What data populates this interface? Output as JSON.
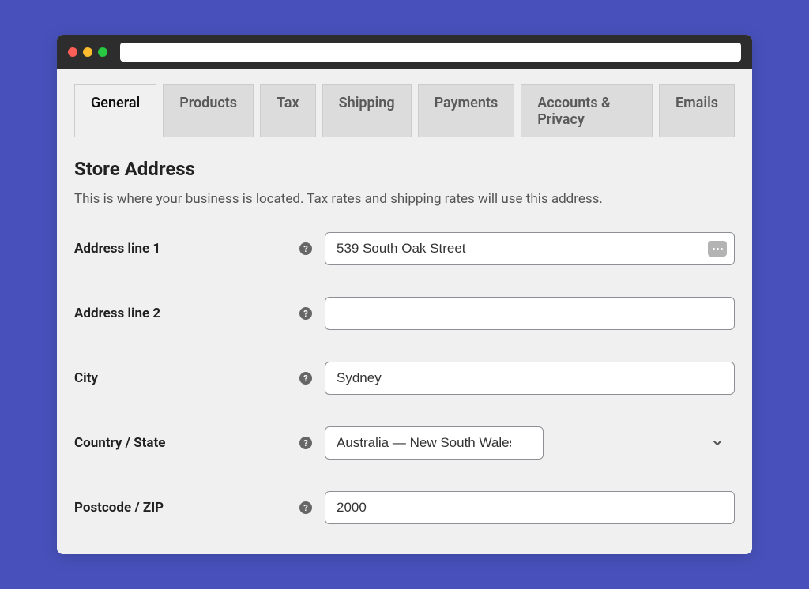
{
  "tabs": [
    {
      "label": "General",
      "active": true
    },
    {
      "label": "Products",
      "active": false
    },
    {
      "label": "Tax",
      "active": false
    },
    {
      "label": "Shipping",
      "active": false
    },
    {
      "label": "Payments",
      "active": false
    },
    {
      "label": "Accounts & Privacy",
      "active": false
    },
    {
      "label": "Emails",
      "active": false
    }
  ],
  "section": {
    "title": "Store Address",
    "description": "This is where your business is located. Tax rates and shipping rates will use this address."
  },
  "fields": {
    "address1": {
      "label": "Address line 1",
      "value": "539 South Oak Street"
    },
    "address2": {
      "label": "Address line 2",
      "value": ""
    },
    "city": {
      "label": "City",
      "value": "Sydney"
    },
    "country_state": {
      "label": "Country / State",
      "value": "Australia — New South Wales"
    },
    "postcode": {
      "label": "Postcode / ZIP",
      "value": "2000"
    }
  }
}
